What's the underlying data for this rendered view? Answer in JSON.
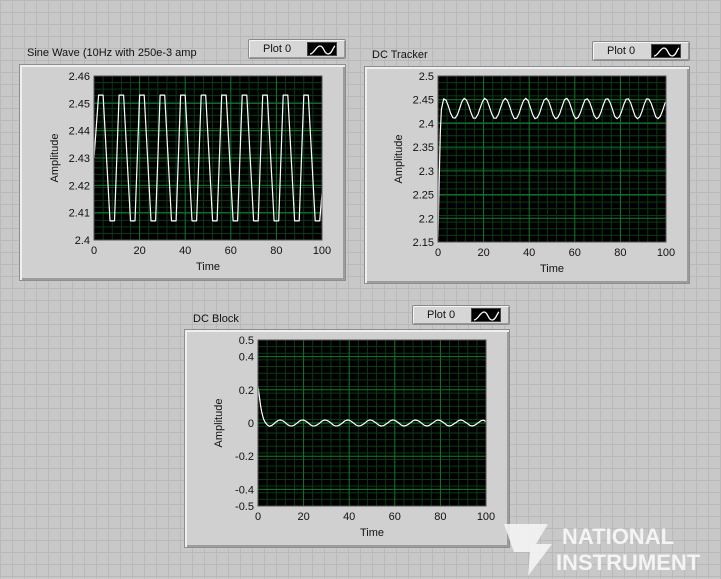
{
  "charts": [
    {
      "caption": "Sine Wave (10Hz with 250e-3 amp",
      "legend": "Plot 0"
    },
    {
      "caption": "DC Tracker",
      "legend": "Plot 0"
    },
    {
      "caption": "DC Block",
      "legend": "Plot 0"
    }
  ],
  "logo_text": [
    "NATIONAL",
    "INSTRUMENT"
  ],
  "colors": {
    "plot_bg": "#000000",
    "grid_major": "#0f7a2a",
    "grid_minor": "#0a3a14",
    "trace": "#ffffff",
    "window": "#c8c8c8"
  },
  "chart_data": [
    {
      "type": "line",
      "title": "",
      "xlabel": "Time",
      "ylabel": "Amplitude",
      "xlim": [
        0,
        100
      ],
      "ylim": [
        2.4,
        2.46
      ],
      "xticks": [
        "0",
        "20",
        "40",
        "60",
        "80",
        "100"
      ],
      "yticks": [
        "2.4",
        "2.41",
        "2.42",
        "2.43",
        "2.44",
        "2.45",
        "2.46"
      ],
      "grid": true,
      "series": [
        {
          "name": "Plot 0",
          "x": [
            0,
            2,
            4,
            7,
            9,
            11,
            13,
            16,
            18,
            20,
            22,
            25,
            27,
            29,
            31,
            34,
            36,
            38,
            40,
            43,
            45,
            47,
            49,
            52,
            54,
            56,
            58,
            61,
            63,
            65,
            67,
            70,
            72,
            74,
            76,
            79,
            81,
            83,
            85,
            88,
            90,
            92,
            94,
            97,
            99,
            100
          ],
          "y": [
            2.43,
            2.453,
            2.453,
            2.407,
            2.407,
            2.453,
            2.453,
            2.407,
            2.407,
            2.453,
            2.453,
            2.407,
            2.407,
            2.453,
            2.453,
            2.407,
            2.407,
            2.453,
            2.453,
            2.407,
            2.407,
            2.453,
            2.453,
            2.407,
            2.407,
            2.453,
            2.453,
            2.407,
            2.407,
            2.453,
            2.453,
            2.407,
            2.407,
            2.453,
            2.453,
            2.407,
            2.407,
            2.453,
            2.453,
            2.407,
            2.407,
            2.453,
            2.453,
            2.407,
            2.407,
            2.417
          ]
        }
      ]
    },
    {
      "type": "line",
      "title": "",
      "xlabel": "Time",
      "ylabel": "Amplitude",
      "xlim": [
        0,
        100
      ],
      "ylim": [
        2.15,
        2.5
      ],
      "xticks": [
        "0",
        "20",
        "40",
        "60",
        "80",
        "100"
      ],
      "yticks": [
        "2.15",
        "2.2",
        "2.25",
        "2.3",
        "2.35",
        "2.4",
        "2.45",
        "2.5"
      ],
      "grid": true,
      "series": [
        {
          "name": "Plot 0",
          "x": [
            0,
            0.6,
            1,
            1.5,
            2.5,
            3.5,
            4.5,
            5.5,
            6.5,
            7.5,
            8.5,
            9.5,
            10.5,
            11.5,
            12.5,
            13.5,
            14.5,
            15.5,
            16.5,
            17.5,
            18.5,
            19.5,
            20.5,
            21.5,
            22.5,
            23.5,
            24.5,
            25.5,
            26.5,
            27.5,
            28.5,
            29.5,
            30.5,
            31.5,
            32.5,
            33.5,
            34.5,
            35.5,
            36.5,
            37.5,
            38.5,
            39.5,
            40.5,
            41.5,
            42.5,
            43.5,
            44.5,
            45.5,
            46.5,
            47.5,
            48.5,
            49.5,
            50.5,
            51.5,
            52.5,
            53.5,
            54.5,
            55.5,
            56.5,
            57.5,
            58.5,
            59.5,
            60.5,
            61.5,
            62.5,
            63.5,
            64.5,
            65.5,
            66.5,
            67.5,
            68.5,
            69.5,
            70.5,
            71.5,
            72.5,
            73.5,
            74.5,
            75.5,
            76.5,
            77.5,
            78.5,
            79.5,
            80.5,
            81.5,
            82.5,
            83.5,
            84.5,
            85.5,
            86.5,
            87.5,
            88.5,
            89.5,
            90.5,
            91.5,
            92.5,
            93.5,
            94.5,
            95.5,
            96.5,
            97.5,
            98.5,
            99.5,
            100
          ],
          "y": [
            2.16,
            2.3,
            2.38,
            2.43,
            2.452,
            2.449,
            2.437,
            2.422,
            2.412,
            2.411,
            2.418,
            2.432,
            2.446,
            2.453,
            2.449,
            2.437,
            2.422,
            2.411,
            2.411,
            2.419,
            2.433,
            2.446,
            2.453,
            2.449,
            2.436,
            2.421,
            2.411,
            2.411,
            2.419,
            2.434,
            2.447,
            2.453,
            2.448,
            2.435,
            2.42,
            2.41,
            2.411,
            2.42,
            2.435,
            2.448,
            2.453,
            2.448,
            2.434,
            2.419,
            2.41,
            2.412,
            2.421,
            2.436,
            2.449,
            2.453,
            2.447,
            2.433,
            2.418,
            2.41,
            2.412,
            2.422,
            2.437,
            2.45,
            2.453,
            2.446,
            2.432,
            2.417,
            2.41,
            2.413,
            2.423,
            2.438,
            2.45,
            2.452,
            2.445,
            2.431,
            2.416,
            2.41,
            2.413,
            2.424,
            2.439,
            2.451,
            2.452,
            2.444,
            2.43,
            2.415,
            2.41,
            2.414,
            2.425,
            2.44,
            2.451,
            2.452,
            2.443,
            2.429,
            2.415,
            2.41,
            2.414,
            2.426,
            2.441,
            2.452,
            2.451,
            2.442,
            2.428,
            2.414,
            2.41,
            2.415,
            2.427,
            2.442,
            2.446
          ]
        }
      ]
    },
    {
      "type": "line",
      "title": "",
      "xlabel": "Time",
      "ylabel": "Amplitude",
      "xlim": [
        0,
        100
      ],
      "ylim": [
        -0.5,
        0.5
      ],
      "xticks": [
        "0",
        "20",
        "40",
        "60",
        "80",
        "100"
      ],
      "yticks": [
        "-0.5",
        "-0.4",
        "-0.2",
        "0",
        "0.2",
        "0.4",
        "0.5"
      ],
      "grid": true,
      "series": [
        {
          "name": "Plot 0",
          "x": [
            0,
            0.4,
            0.8,
            1.2,
            1.6,
            2,
            2.4,
            3,
            4,
            5,
            6,
            7,
            8,
            9,
            10,
            11,
            12,
            13,
            14,
            15,
            16,
            17,
            18,
            19,
            20,
            21,
            22,
            23,
            24,
            25,
            26,
            27,
            28,
            29,
            30,
            31,
            32,
            33,
            34,
            35,
            36,
            37,
            38,
            39,
            40,
            41,
            42,
            43,
            44,
            45,
            46,
            47,
            48,
            49,
            50,
            51,
            52,
            53,
            54,
            55,
            56,
            57,
            58,
            59,
            60,
            61,
            62,
            63,
            64,
            65,
            66,
            67,
            68,
            69,
            70,
            71,
            72,
            73,
            74,
            75,
            76,
            77,
            78,
            79,
            80,
            81,
            82,
            83,
            84,
            85,
            86,
            87,
            88,
            89,
            90,
            91,
            92,
            93,
            94,
            95,
            96,
            97,
            98,
            99,
            100
          ],
          "y": [
            0.22,
            0.18,
            0.14,
            0.1,
            0.07,
            0.045,
            0.025,
            0.008,
            -0.01,
            -0.02,
            -0.015,
            -0.005,
            0.008,
            0.016,
            0.018,
            0.012,
            0.002,
            -0.01,
            -0.017,
            -0.018,
            -0.012,
            -0.002,
            0.01,
            0.017,
            0.018,
            0.011,
            0.001,
            -0.011,
            -0.018,
            -0.017,
            -0.011,
            -0.001,
            0.011,
            0.018,
            0.017,
            0.01,
            0,
            -0.012,
            -0.018,
            -0.017,
            -0.01,
            0,
            0.012,
            0.018,
            0.017,
            0.009,
            -0.001,
            -0.012,
            -0.018,
            -0.016,
            -0.009,
            0.001,
            0.013,
            0.018,
            0.016,
            0.008,
            -0.002,
            -0.013,
            -0.018,
            -0.016,
            -0.008,
            0.002,
            0.013,
            0.018,
            0.016,
            0.008,
            -0.003,
            -0.014,
            -0.018,
            -0.015,
            -0.007,
            0.003,
            0.014,
            0.018,
            0.015,
            0.007,
            -0.004,
            -0.014,
            -0.018,
            -0.015,
            -0.006,
            0.004,
            0.014,
            0.018,
            0.015,
            0.006,
            -0.004,
            -0.015,
            -0.018,
            -0.014,
            -0.005,
            0.005,
            0.015,
            0.018,
            0.014,
            0.005,
            -0.005,
            -0.015,
            -0.018,
            -0.014,
            -0.004,
            0.006,
            0.015,
            0.017,
            0.008
          ]
        }
      ]
    }
  ]
}
